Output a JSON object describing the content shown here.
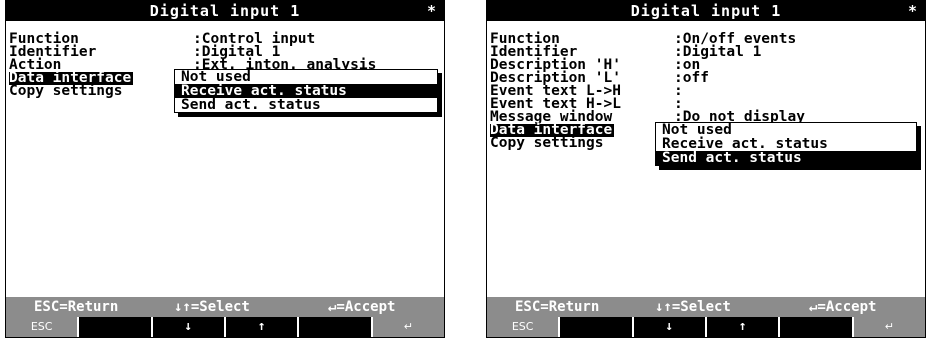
{
  "left": {
    "title": "Digital input 1",
    "marker": "*",
    "rows": [
      {
        "label": "Function",
        "value": ":Control input"
      },
      {
        "label": "Identifier",
        "value": ":Digital 1"
      },
      {
        "label": "Action",
        "value": ":Ext. inton. analysis"
      },
      {
        "label": "Data interface",
        "value": ""
      },
      {
        "label": "Copy settings",
        "value": ""
      }
    ],
    "popup_options": [
      "Not used",
      "Receive act. status",
      "Send act. status"
    ],
    "popup_selected": "Receive act. status"
  },
  "right": {
    "title": "Digital input 1",
    "marker": "*",
    "rows": [
      {
        "label": "Function",
        "value": ":On/off events"
      },
      {
        "label": "Identifier",
        "value": ":Digital 1"
      },
      {
        "label": "Description 'H'",
        "value": ":on"
      },
      {
        "label": "Description 'L'",
        "value": ":off"
      },
      {
        "label": "Event text L->H",
        "value": ":"
      },
      {
        "label": "Event text H->L",
        "value": ":"
      },
      {
        "label": "Message window",
        "value": ":Do not display"
      },
      {
        "label": "Data interface",
        "value": ""
      },
      {
        "label": "Copy settings",
        "value": ""
      }
    ],
    "popup_options": [
      "Not used",
      "Receive act. status",
      "Send act. status"
    ],
    "popup_selected": "Send act. status"
  },
  "footer": {
    "esc_hint": "ESC=Return",
    "select_hint": "↓↑=Select",
    "accept_hint": "↵=Accept"
  },
  "softkeys": [
    "ESC",
    "",
    "↓",
    "↑",
    "",
    "↵"
  ]
}
